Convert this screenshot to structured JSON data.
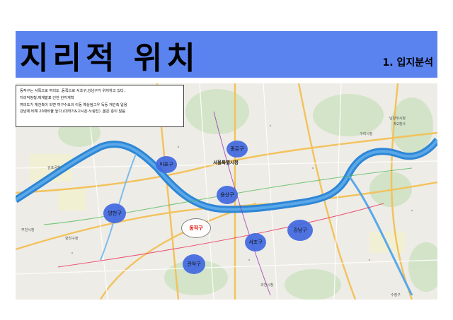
{
  "slide": {
    "title": "지리적 위치",
    "subtitle": "1. 입지분석"
  },
  "info_box": {
    "lines": [
      "동작구는 서쪽으로 여의도 ,동쪽으로 서초구,강남구가 위치하고 있다.",
      "지리적정형,체계발표 인한 한지계혁",
      "여의도가 재건축이 되면 여구수요의 이동 예상됨그우 독동 재건축 일용",
      "강남에 비해 20대비율 높다.(대학가&고시촌-노량진) ,젊은 층이 많음"
    ]
  },
  "districts": [
    {
      "name": "마포구",
      "highlight": false
    },
    {
      "name": "종로구",
      "highlight": false
    },
    {
      "name": "용산구",
      "highlight": false
    },
    {
      "name": "양천구",
      "highlight": false
    },
    {
      "name": "동작구",
      "highlight": true
    },
    {
      "name": "서초구",
      "highlight": false
    },
    {
      "name": "강남구",
      "highlight": false
    },
    {
      "name": "관악구",
      "highlight": false
    }
  ],
  "map_labels": {
    "seoul_station": "서울특별시청",
    "guri": "구리시청",
    "namyangju": "남양주시청",
    "namyangju2": "제2청사",
    "bucheon": "부천시청",
    "yangcheon_office": "양천구청",
    "gimpo": "김포공항",
    "gwacheon": "과천시청",
    "sujeong": "수정구"
  },
  "colors": {
    "banner": "#5b83f0",
    "marker": "#4169e1",
    "river": "#2e86d6",
    "highlight_text": "#e00000"
  }
}
